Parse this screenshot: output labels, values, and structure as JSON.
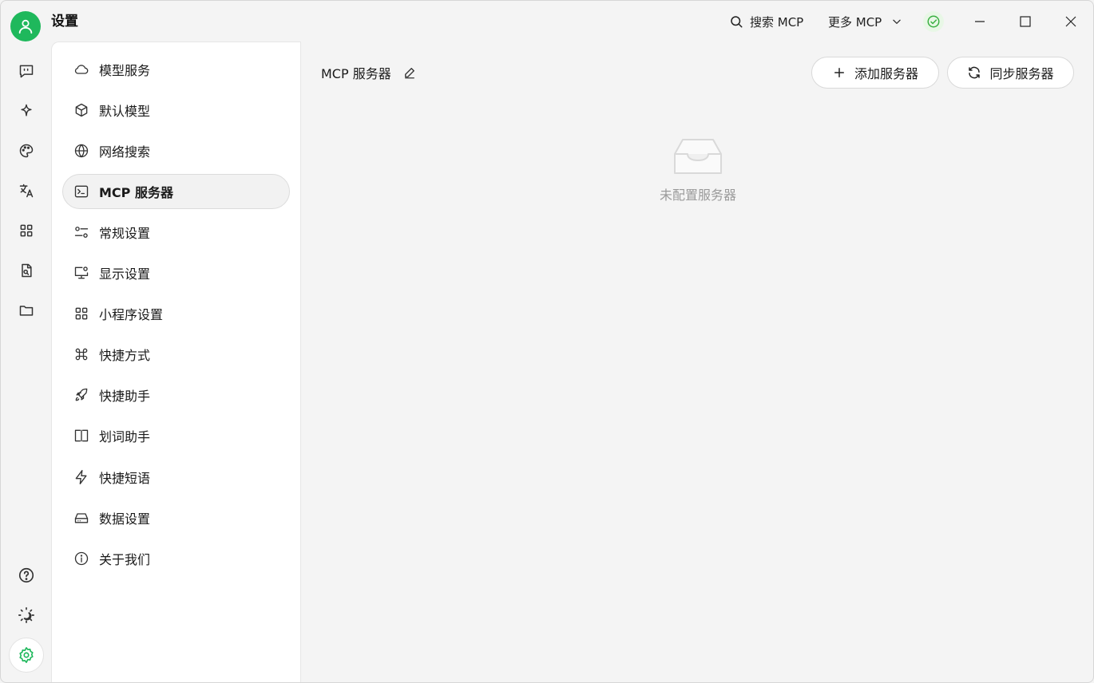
{
  "window": {
    "title": "设置",
    "search_label": "搜索 MCP",
    "more_label": "更多 MCP",
    "accent": "#1fb85c"
  },
  "nav": {
    "items": [
      {
        "label": "模型服务",
        "icon": "cloud-icon"
      },
      {
        "label": "默认模型",
        "icon": "cube-icon"
      },
      {
        "label": "网络搜索",
        "icon": "globe-icon"
      },
      {
        "label": "MCP 服务器",
        "icon": "terminal-icon",
        "active": true
      },
      {
        "label": "常规设置",
        "icon": "sliders-icon"
      },
      {
        "label": "显示设置",
        "icon": "monitor-settings-icon"
      },
      {
        "label": "小程序设置",
        "icon": "grid-icon"
      },
      {
        "label": "快捷方式",
        "icon": "command-icon"
      },
      {
        "label": "快捷助手",
        "icon": "rocket-icon"
      },
      {
        "label": "划词助手",
        "icon": "text-cursor-icon"
      },
      {
        "label": "快捷短语",
        "icon": "zap-icon"
      },
      {
        "label": "数据设置",
        "icon": "hard-drive-icon"
      },
      {
        "label": "关于我们",
        "icon": "info-icon"
      }
    ]
  },
  "main": {
    "title": "MCP 服务器",
    "add_button": "添加服务器",
    "sync_button": "同步服务器",
    "empty_text": "未配置服务器"
  }
}
